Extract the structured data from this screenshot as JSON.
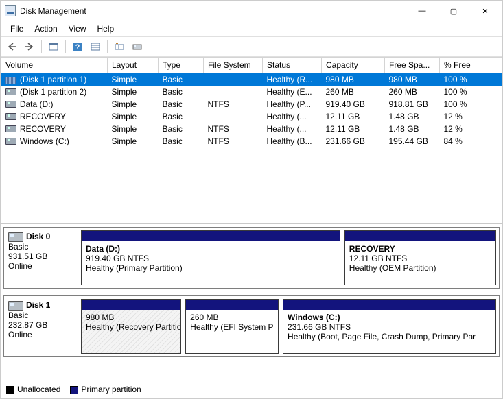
{
  "window": {
    "title": "Disk Management",
    "min": "—",
    "max": "▢",
    "close": "✕"
  },
  "menu": {
    "file": "File",
    "action": "Action",
    "view": "View",
    "help": "Help"
  },
  "columns": {
    "volume": "Volume",
    "layout": "Layout",
    "type": "Type",
    "filesystem": "File System",
    "status": "Status",
    "capacity": "Capacity",
    "freespace": "Free Spa...",
    "pctfree": "% Free"
  },
  "volumes": [
    {
      "name": "(Disk 1 partition 1)",
      "layout": "Simple",
      "type": "Basic",
      "fs": "",
      "status": "Healthy (R...",
      "capacity": "980 MB",
      "free": "980 MB",
      "pct": "100 %",
      "icon": "stripe",
      "selected": true
    },
    {
      "name": "(Disk 1 partition 2)",
      "layout": "Simple",
      "type": "Basic",
      "fs": "",
      "status": "Healthy (E...",
      "capacity": "260 MB",
      "free": "260 MB",
      "pct": "100 %",
      "icon": "drive"
    },
    {
      "name": "Data (D:)",
      "layout": "Simple",
      "type": "Basic",
      "fs": "NTFS",
      "status": "Healthy (P...",
      "capacity": "919.40 GB",
      "free": "918.81 GB",
      "pct": "100 %",
      "icon": "drive"
    },
    {
      "name": "RECOVERY",
      "layout": "Simple",
      "type": "Basic",
      "fs": "",
      "status": "Healthy (...",
      "capacity": "12.11 GB",
      "free": "1.48 GB",
      "pct": "12 %",
      "icon": "drive"
    },
    {
      "name": "RECOVERY",
      "layout": "Simple",
      "type": "Basic",
      "fs": "NTFS",
      "status": "Healthy (...",
      "capacity": "12.11 GB",
      "free": "1.48 GB",
      "pct": "12 %",
      "icon": "drive"
    },
    {
      "name": "Windows (C:)",
      "layout": "Simple",
      "type": "Basic",
      "fs": "NTFS",
      "status": "Healthy (B...",
      "capacity": "231.66 GB",
      "free": "195.44 GB",
      "pct": "84 %",
      "icon": "drive"
    }
  ],
  "disks": [
    {
      "name": "Disk 0",
      "type": "Basic",
      "size": "931.51 GB",
      "status": "Online",
      "parts": [
        {
          "title": "Data  (D:)",
          "line2": "919.40 GB NTFS",
          "line3": "Healthy (Primary Partition)",
          "flex": 360
        },
        {
          "title": "RECOVERY",
          "line2": "12.11 GB NTFS",
          "line3": "Healthy (OEM Partition)",
          "flex": 210
        }
      ]
    },
    {
      "name": "Disk 1",
      "type": "Basic",
      "size": "232.87 GB",
      "status": "Online",
      "parts": [
        {
          "title": "",
          "line2": "980 MB",
          "line3": "Healthy (Recovery Partition",
          "flex": 140,
          "hatched": true
        },
        {
          "title": "",
          "line2": "260 MB",
          "line3": "Healthy (EFI System P",
          "flex": 130
        },
        {
          "title": "Windows  (C:)",
          "line2": "231.66 GB NTFS",
          "line3": "Healthy (Boot, Page File, Crash Dump, Primary Par",
          "flex": 300
        }
      ]
    }
  ],
  "legend": {
    "unallocated": "Unallocated",
    "primary": "Primary partition"
  }
}
